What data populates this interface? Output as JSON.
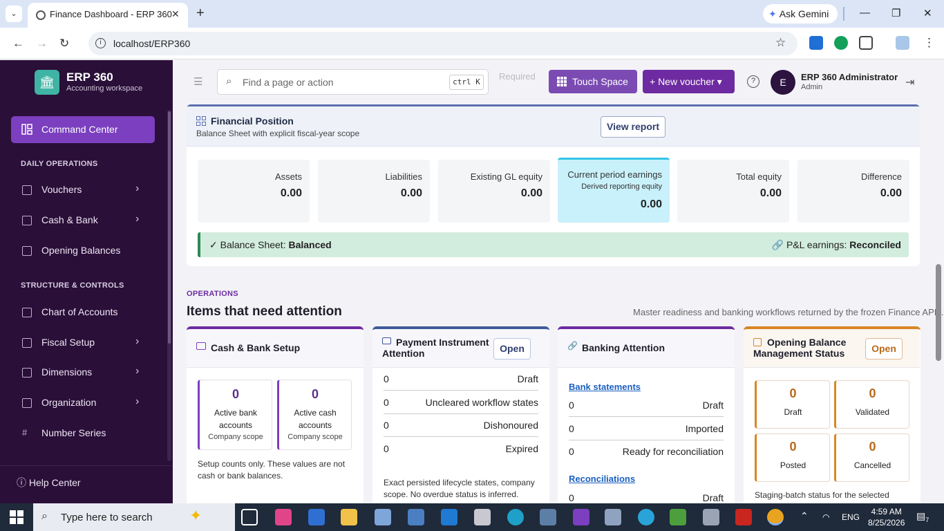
{
  "browser": {
    "tab_title": "Finance Dashboard - ERP 360",
    "url": "localhost/ERP360",
    "gemini_label": "Ask Gemini",
    "tab_close": "✕",
    "new_tab": "+",
    "tab_menu": "⌄"
  },
  "sidebar": {
    "brand_name": "ERP 360",
    "brand_sub": "Accounting workspace",
    "active_item": "Command Center",
    "sections": [
      {
        "title": "DAILY OPERATIONS"
      },
      {
        "title": "STRUCTURE & CONTROLS"
      }
    ],
    "items": [
      {
        "label": "Vouchers",
        "icon": "voucher-icon"
      },
      {
        "label": "Cash & Bank",
        "icon": "wallet-icon"
      },
      {
        "label": "Opening Balances",
        "icon": "ledger-icon"
      },
      {
        "label": "Chart of Accounts",
        "icon": "hierarchy-icon"
      },
      {
        "label": "Fiscal Setup",
        "icon": "calendar-icon"
      },
      {
        "label": "Dimensions",
        "icon": "grid-icon"
      },
      {
        "label": "Organization",
        "icon": "building-icon"
      },
      {
        "label": "Number Series",
        "icon": "hash-icon"
      }
    ],
    "help": "Help Center"
  },
  "topbar": {
    "search_placeholder": "Find a page or action",
    "shortcut": "ctrl K",
    "touch_space": "Touch Space",
    "new_voucher": "+ New voucher ▾",
    "user_initial": "E",
    "user_name": "ERP 360 Administrator",
    "user_role": "Admin",
    "faint_text": "Required"
  },
  "financial_position": {
    "title": "Financial Position",
    "subtitle": "Balance Sheet with explicit fiscal-year scope",
    "view_report": "View report",
    "metrics": [
      {
        "label": "Assets",
        "value": "0.00"
      },
      {
        "label": "Liabilities",
        "value": "0.00"
      },
      {
        "label": "Existing GL equity",
        "value": "0.00"
      },
      {
        "label": "Current period earnings",
        "sub": "Derived reporting equity",
        "value": "0.00"
      },
      {
        "label": "Total equity",
        "value": "0.00"
      },
      {
        "label": "Difference",
        "value": "0.00"
      }
    ],
    "balance_label": "Balance Sheet:",
    "balance_value": "Balanced",
    "pl_label": "P&L earnings:",
    "pl_value": "Reconciled"
  },
  "operations": {
    "eyebrow": "OPERATIONS",
    "title": "Items that need attention",
    "note": "Master readiness and banking workflows returned by the frozen Finance APIs.",
    "cash_bank": {
      "title": "Cash & Bank Setup",
      "boxes": [
        {
          "count": "0",
          "label": "Active bank accounts",
          "scope": "Company scope"
        },
        {
          "count": "0",
          "label": "Active cash accounts",
          "scope": "Company scope"
        }
      ],
      "footnote": "Setup counts only. These values are not cash or bank balances."
    },
    "payment_instrument": {
      "title": "Payment Instrument Attention",
      "open": "Open",
      "rows": [
        {
          "count": "0",
          "label": "Draft"
        },
        {
          "count": "0",
          "label": "Uncleared workflow states"
        },
        {
          "count": "0",
          "label": "Dishonoured"
        },
        {
          "count": "0",
          "label": "Expired"
        }
      ],
      "footnote": "Exact persisted lifecycle states, company scope. No overdue status is inferred."
    },
    "banking": {
      "title": "Banking Attention",
      "statements_link": "Bank statements",
      "statement_rows": [
        {
          "count": "0",
          "label": "Draft"
        },
        {
          "count": "0",
          "label": "Imported"
        },
        {
          "count": "0",
          "label": "Ready for reconciliation"
        }
      ],
      "recon_link": "Reconciliations",
      "recon_rows": [
        {
          "count": "0",
          "label": "Draft"
        }
      ]
    },
    "opening_balance": {
      "title": "Opening Balance Management Status",
      "open": "Open",
      "boxes": [
        {
          "count": "0",
          "label": "Draft"
        },
        {
          "count": "0",
          "label": "Validated"
        },
        {
          "count": "0",
          "label": "Posted"
        },
        {
          "count": "0",
          "label": "Cancelled"
        }
      ],
      "footnote": "Staging-batch status for the selected"
    }
  },
  "taskbar": {
    "search_placeholder": "Type here to search",
    "lang": "ENG",
    "time": "4:59 AM",
    "date": "8/25/2026",
    "notif_count": "7"
  },
  "colors": {
    "sidebar_bg": "#2a0f38",
    "accent_purple": "#7b3fbf",
    "balanced_green": "#d2ecde",
    "highlight_cyan": "#c9f1fb",
    "opening_orange": "#d88524"
  }
}
